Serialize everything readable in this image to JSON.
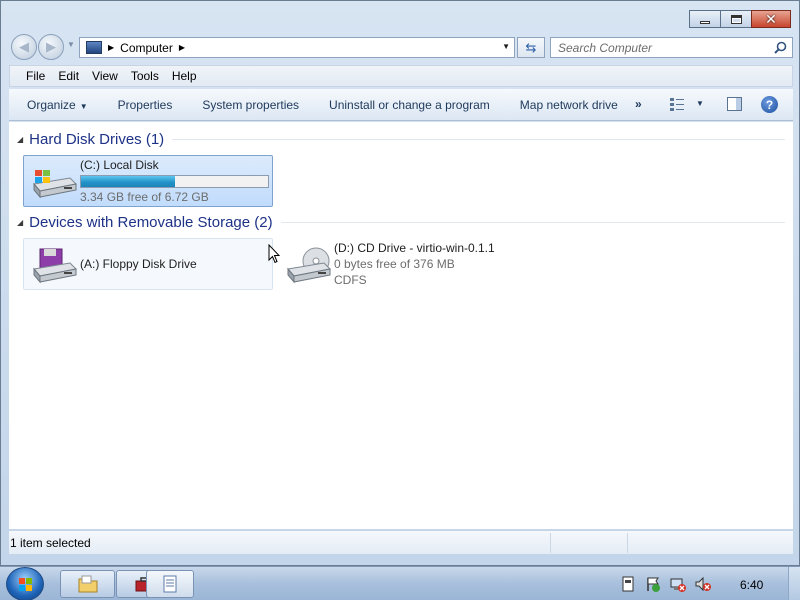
{
  "navbar": {
    "address": {
      "location": "Computer"
    },
    "search": {
      "placeholder": "Search Computer"
    }
  },
  "menu": {
    "items": [
      {
        "label": "File"
      },
      {
        "label": "Edit"
      },
      {
        "label": "View"
      },
      {
        "label": "Tools"
      },
      {
        "label": "Help"
      }
    ]
  },
  "toolbar": {
    "organize": "Organize",
    "properties": "Properties",
    "system_properties": "System properties",
    "uninstall": "Uninstall or change a program",
    "map_drive": "Map network drive",
    "more": "»"
  },
  "groups": {
    "hard_disks": {
      "title": "Hard Disk Drives (1)",
      "items": [
        {
          "name": "(C:) Local Disk",
          "free_text": "3.34 GB free of 6.72 GB",
          "used_fraction": 0.503,
          "icon": "hard-disk-windows-icon"
        }
      ]
    },
    "removable": {
      "title": "Devices with Removable Storage (2)",
      "items": [
        {
          "name": "(A:) Floppy Disk Drive",
          "icon": "floppy-drive-icon"
        },
        {
          "name": "(D:) CD Drive - virtio-win-0.1.1",
          "free_text": "0 bytes free of 376 MB",
          "fs": "CDFS",
          "icon": "cd-drive-icon"
        }
      ]
    }
  },
  "status": {
    "text": "1 item selected"
  },
  "taskbar": {
    "clock": "6:40",
    "buttons": [
      {
        "icon": "explorer-folder-icon"
      },
      {
        "icon": "toolbox-icon"
      },
      {
        "icon": "document-icon"
      }
    ],
    "tray": [
      {
        "icon": "network-device-icon"
      },
      {
        "icon": "action-center-flag-icon"
      },
      {
        "icon": "network-error-icon"
      },
      {
        "icon": "volume-muted-icon"
      }
    ]
  },
  "colors": {
    "accent": "#1e3287",
    "selection": "#c1dcfc",
    "progress": "#2394c9"
  }
}
